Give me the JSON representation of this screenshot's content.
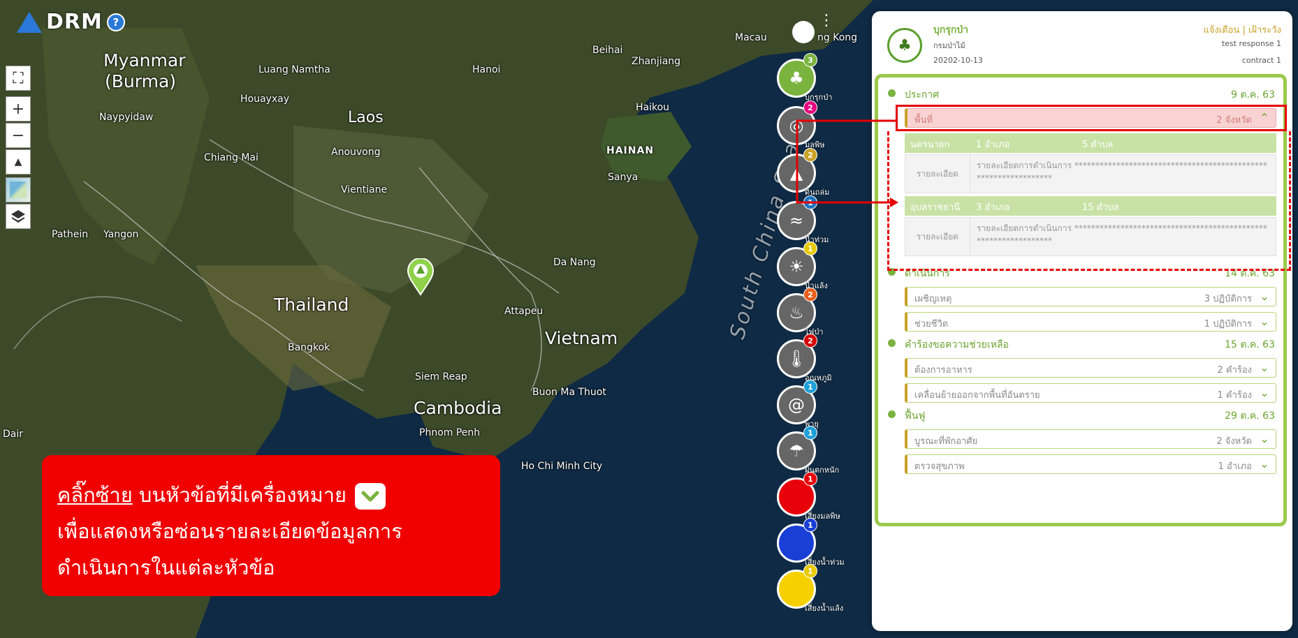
{
  "app": {
    "brand": "DRM",
    "help_glyph": "?"
  },
  "map": {
    "labels": {
      "myanmar": "Myanmar",
      "burma": "(Burma)",
      "laos": "Laos",
      "thailand": "Thailand",
      "vietnam": "Vietnam",
      "cambodia": "Cambodia",
      "hainan": "HAINAN",
      "macau": "Macau",
      "hong_kong": "ng Kong",
      "beihai": "Beihai",
      "zhanjiang": "Zhanjiang",
      "hanoi": "Hanoi",
      "haikou": "Haikou",
      "sanya": "Sanya",
      "da_nang": "Da Nang",
      "attapeu": "Attapeu",
      "siem_reap": "Siem Reap",
      "buon_ma_thuot": "Buon Ma Thuot",
      "phnom_penh": "Phnom Penh",
      "ho_chi_minh": "Ho Chi Minh City",
      "bangkok": "Bangkok",
      "vientiane": "Vientiane",
      "chiang_mai": "Chiang Mai",
      "luang_namtha": "Luang Namtha",
      "houayxay": "Houayxay",
      "anouvong": "Anouvong",
      "naypyidaw": "Naypyidaw",
      "pathein": "Pathein",
      "yangon": "Yangon",
      "dair": "Dair",
      "sea": "South China Sea"
    }
  },
  "tools": {
    "expand": "⛶",
    "zoom_in": "+",
    "zoom_out": "−",
    "compass": "▲"
  },
  "layers": [
    {
      "label": "บุกรุกป่า",
      "badge": "3",
      "color": "#7ab33e",
      "badge_color": "#7ab33e",
      "icon": "tree-icon",
      "glyph": "♣"
    },
    {
      "label": "มลพิษ",
      "badge": "2",
      "color": "#666",
      "badge_color": "#e6007e",
      "icon": "pollution-icon",
      "glyph": "◎"
    },
    {
      "label": "ดินถล่ม",
      "badge": "2",
      "color": "#666",
      "badge_color": "#c9a227",
      "icon": "landslide-icon",
      "glyph": "▲"
    },
    {
      "label": "น้ำท่วม",
      "badge": "1",
      "color": "#666",
      "badge_color": "#1e73be",
      "icon": "flood-icon",
      "glyph": "≈"
    },
    {
      "label": "น้ำแล้ง",
      "badge": "1",
      "color": "#666",
      "badge_color": "#e8c900",
      "icon": "drought-icon",
      "glyph": "☀"
    },
    {
      "label": "ไฟป่า",
      "badge": "2",
      "color": "#666",
      "badge_color": "#e8601b",
      "icon": "fire-icon",
      "glyph": "♨"
    },
    {
      "label": "อุณหภูมิ",
      "badge": "2",
      "color": "#666",
      "badge_color": "#d40000",
      "icon": "thermometer-icon",
      "glyph": "🌡"
    },
    {
      "label": "พายุ",
      "badge": "1",
      "color": "#666",
      "badge_color": "#1ea0d8",
      "icon": "storm-icon",
      "glyph": "@"
    },
    {
      "label": "ฝนตกหนัก",
      "badge": "1",
      "color": "#666",
      "badge_color": "#1ea0d8",
      "icon": "rain-icon",
      "glyph": "☂"
    },
    {
      "label": "เสี่ยงมลพิษ",
      "badge": "1",
      "color": "#e8000a",
      "badge_color": "#e8000a",
      "icon": "red-circle-icon",
      "glyph": ""
    },
    {
      "label": "เสี่ยงน้ำท่วม",
      "badge": "1",
      "color": "#1a3fd6",
      "badge_color": "#1a3fd6",
      "icon": "blue-circle-icon",
      "glyph": ""
    },
    {
      "label": "เสี่ยงน้ำแล้ง",
      "badge": "1",
      "color": "#f7d000",
      "badge_color": "#e8c900",
      "icon": "yellow-circle-icon",
      "glyph": ""
    }
  ],
  "panel": {
    "header": {
      "title": "บุกรุกป่า",
      "org": "กรมป่าไม้",
      "date": "20202-10-13",
      "status": "แจ้งเตือน | เฝ้าระวัง",
      "response": "test response 1",
      "contract": "contract 1"
    },
    "sections": [
      {
        "name": "ประกาศ",
        "date": "9 ต.ค. 63"
      },
      {
        "name": "ดำเนินการ",
        "date": "14 ต.ค. 63"
      },
      {
        "name": "คำร้องขอความช่วยเหลือ",
        "date": "15 ต.ค. 63"
      },
      {
        "name": "ฟื้นฟู",
        "date": "29 ต.ค. 63"
      }
    ],
    "area": {
      "name": "พื้นที่",
      "value": "2 จังหวัด",
      "chevron": "^"
    },
    "area_groups": [
      {
        "province": "นครนายก",
        "districts": "1 อำเภอ",
        "subdistricts": "5 ตำบล",
        "detail_key": "รายละเอียด",
        "detail": "รายละเอียดการดำเนินการ ****************************************************************"
      },
      {
        "province": "อุบลราชธานี",
        "districts": "3 อำเภอ",
        "subdistricts": "15 ตำบล",
        "detail_key": "รายละเอียด",
        "detail": "รายละเอียดการดำเนินการ ****************************************************************"
      }
    ],
    "subitems": [
      {
        "name": "เผชิญเหตุ",
        "value": "3 ปฏิบัติการ"
      },
      {
        "name": "ช่วยชีวิต",
        "value": "1 ปฏิบัติการ"
      },
      {
        "name": "ต้องการอาหาร",
        "value": "2 คำร้อง"
      },
      {
        "name": "เคลื่อนย้ายออกจากพื้นที่อันตราย",
        "value": "1 คำร้อง"
      },
      {
        "name": "บูรณะที่พักอาศัย",
        "value": "2 จังหวัด"
      },
      {
        "name": "ตรวจสุขภาพ",
        "value": "1 อำเภอ"
      }
    ]
  },
  "callout": {
    "underlined": "คลิ๊กซ้าย",
    "line1": " บนหัวข้อที่มีเครื่องหมาย",
    "line2": "เพื่อแสดงหรือซ่อนรายละเอียดข้อมูลการ",
    "line3": "ดำเนินการในแต่ละหัวข้อ"
  }
}
